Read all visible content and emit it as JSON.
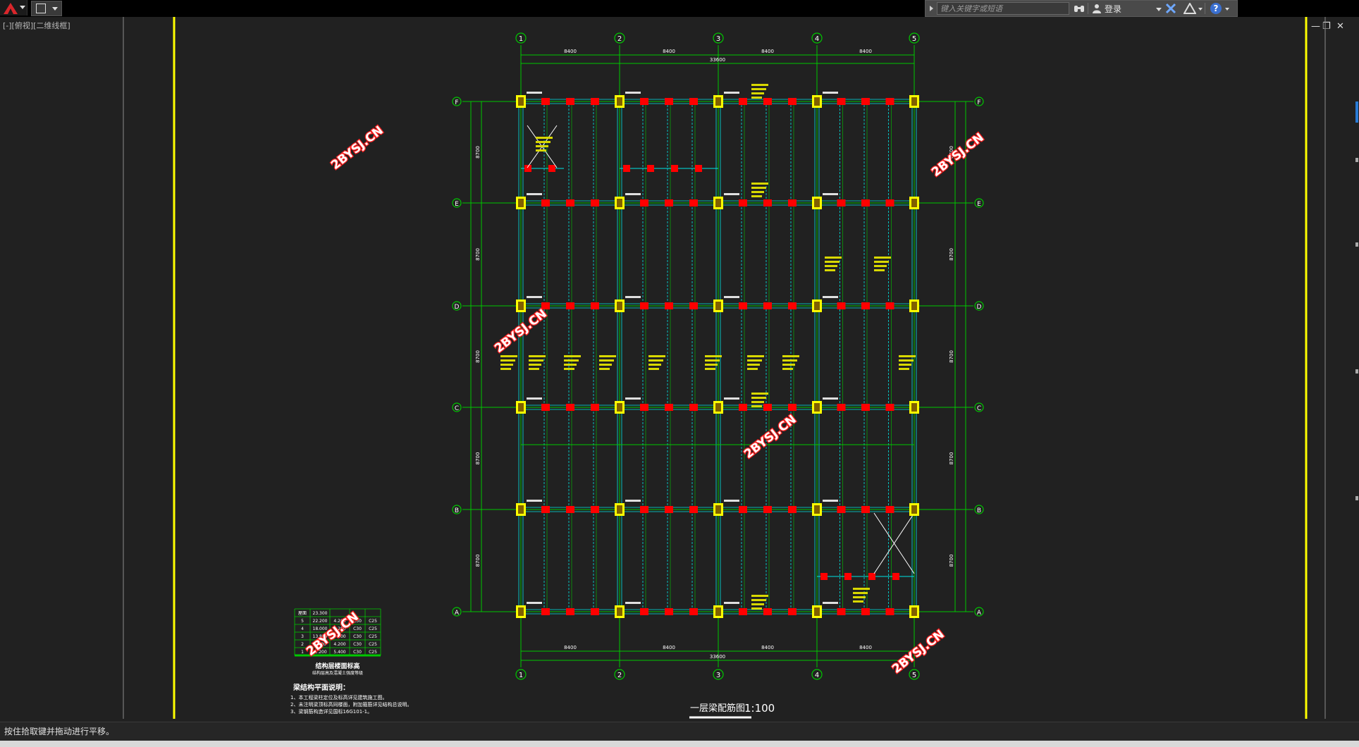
{
  "toolbar": {
    "search_placeholder": "键入关键字或短语",
    "sign_in": "登录",
    "help_label": "?"
  },
  "viewport": {
    "view_controls": "[-][俯视][二维线框]"
  },
  "window_controls": {
    "minimize": "—",
    "restore": "❐",
    "close": "✕"
  },
  "drawing": {
    "grid_columns": [
      "1",
      "2",
      "3",
      "4",
      "5"
    ],
    "grid_rows": [
      "F",
      "E",
      "D",
      "C",
      "B",
      "A"
    ],
    "bay_dims": [
      "8400",
      "8400",
      "8400",
      "8400"
    ],
    "total_dim": "33600",
    "row_dims": [
      "8700",
      "8700",
      "8700",
      "8700",
      "8700"
    ],
    "watermark": "2BYSJ.CN",
    "title": "一层梁配筋图",
    "scale": "1:100",
    "note_title": "梁结构平面说明：",
    "notes": [
      "1、本工程梁柱定位及标高详见建筑施工图。",
      "2、未注明梁顶标高同楼面，附加箍筋详见结构总说明。",
      "3、梁钢筋构造详见国标16G101-1。"
    ],
    "floor_table": [
      [
        "屋面",
        "23.300",
        "",
        "",
        ""
      ],
      [
        "5",
        "22.200",
        "4.200",
        "C30",
        "C25"
      ],
      [
        "4",
        "18.000",
        "4.200",
        "C30",
        "C25"
      ],
      [
        "3",
        "13.800",
        "4.200",
        "C30",
        "C25"
      ],
      [
        "2",
        "9.600",
        "4.200",
        "C30",
        "C25"
      ],
      [
        "1",
        "-1.200",
        "5.400",
        "C30",
        "C25"
      ]
    ],
    "floor_table_caption": "结构层楼面标高",
    "floor_table_sub": "结构层高及混凝土强度等级"
  },
  "status": {
    "prompt": "按住拾取键并拖动进行平移。"
  },
  "colors": {
    "background": "#212121",
    "grid_green": "#00c800",
    "column_yellow": "#ffff00",
    "beam_red": "#ff0000",
    "beam_cyan": "#00e5e5",
    "border_yellow": "#ffff00"
  }
}
